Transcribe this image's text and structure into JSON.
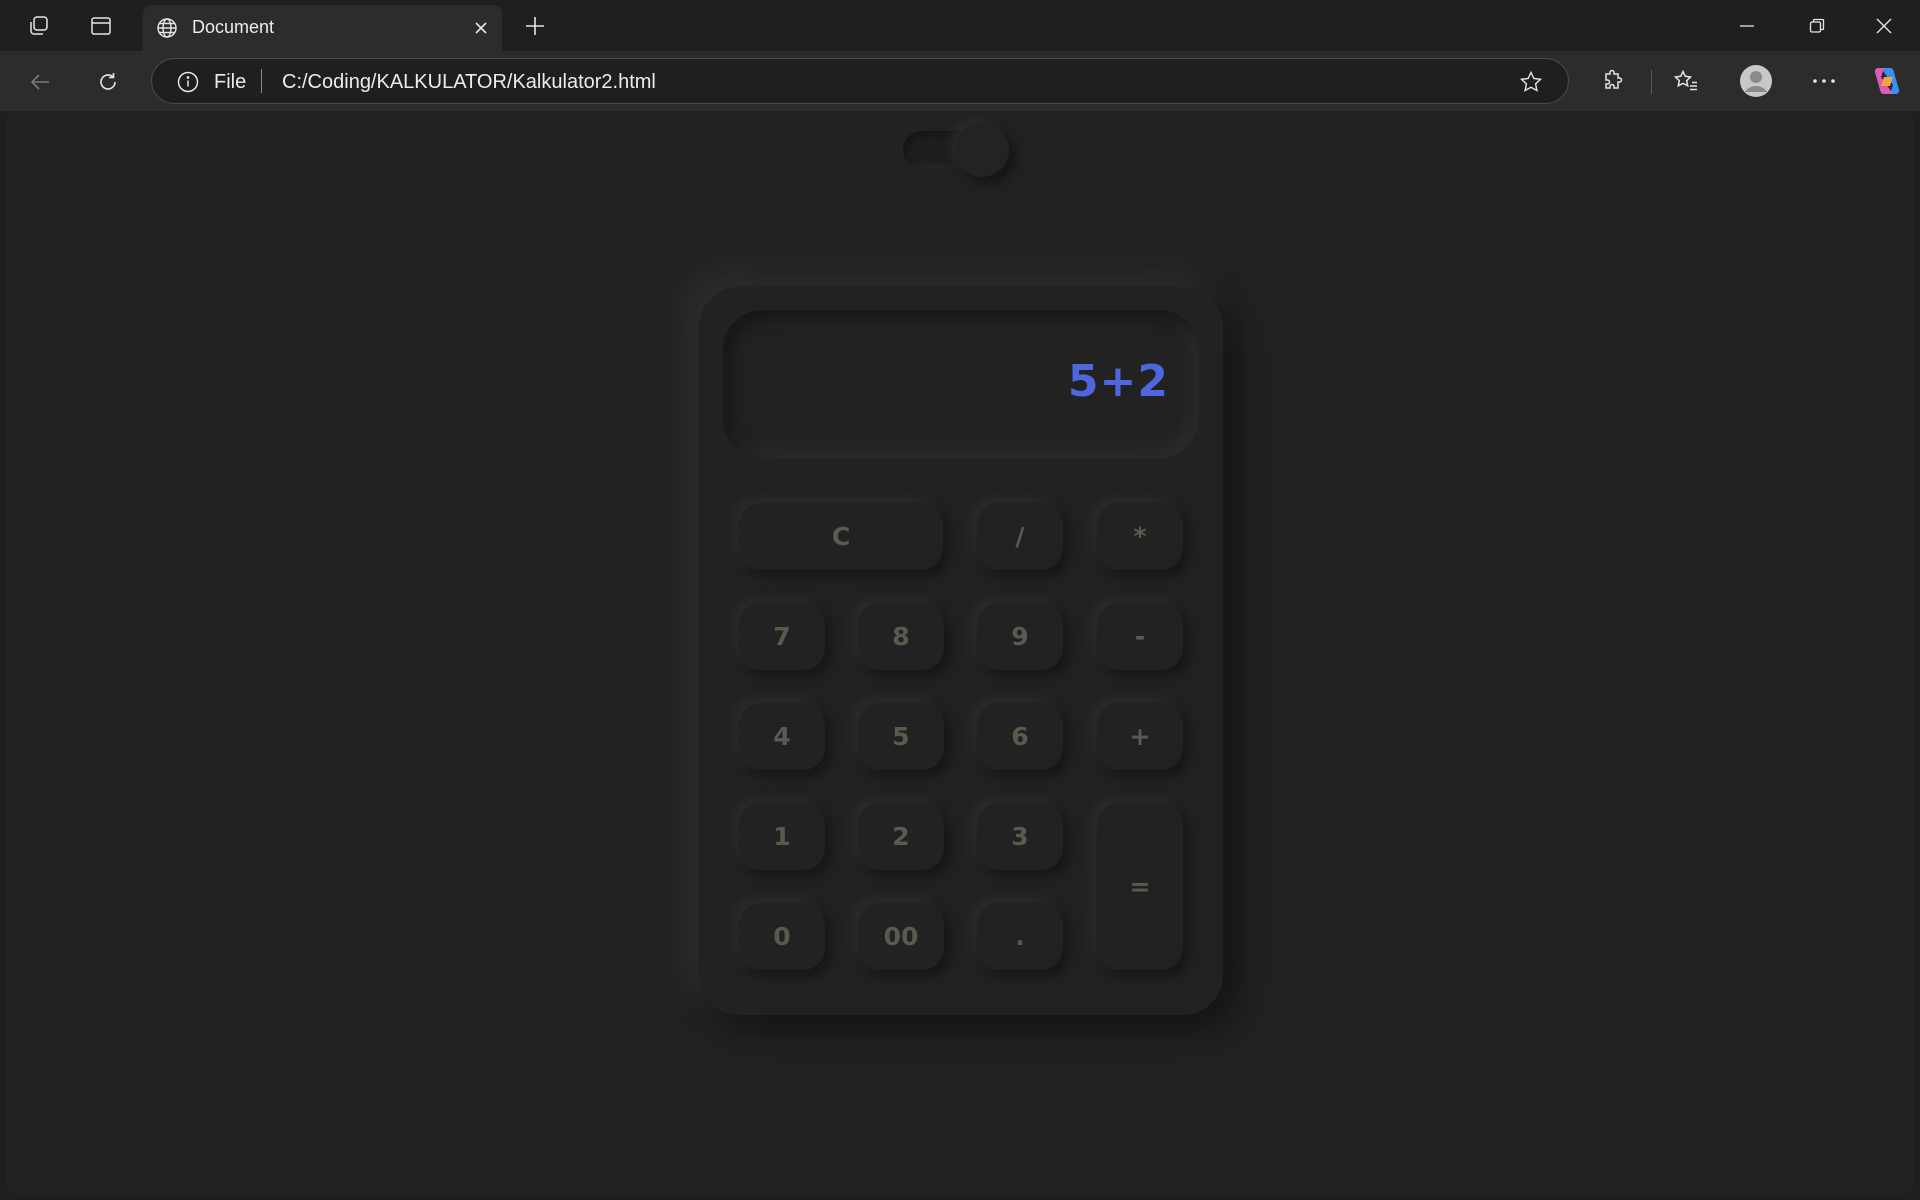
{
  "browser": {
    "tab_title": "Document",
    "address_scheme": "File",
    "url": "C:/Coding/KALKULATOR/Kalkulator2.html"
  },
  "calculator": {
    "display": "5+2",
    "keys": {
      "clear": "C",
      "divide": "/",
      "multiply": "*",
      "seven": "7",
      "eight": "8",
      "nine": "9",
      "minus": "-",
      "four": "4",
      "five": "5",
      "six": "6",
      "plus": "+",
      "one": "1",
      "two": "2",
      "three": "3",
      "equals": "=",
      "zero": "0",
      "double_zero": "00",
      "decimal": "."
    }
  },
  "colors": {
    "display_text": "#4f67dc",
    "key_text": "#5b5a4f",
    "background": "#222222"
  }
}
